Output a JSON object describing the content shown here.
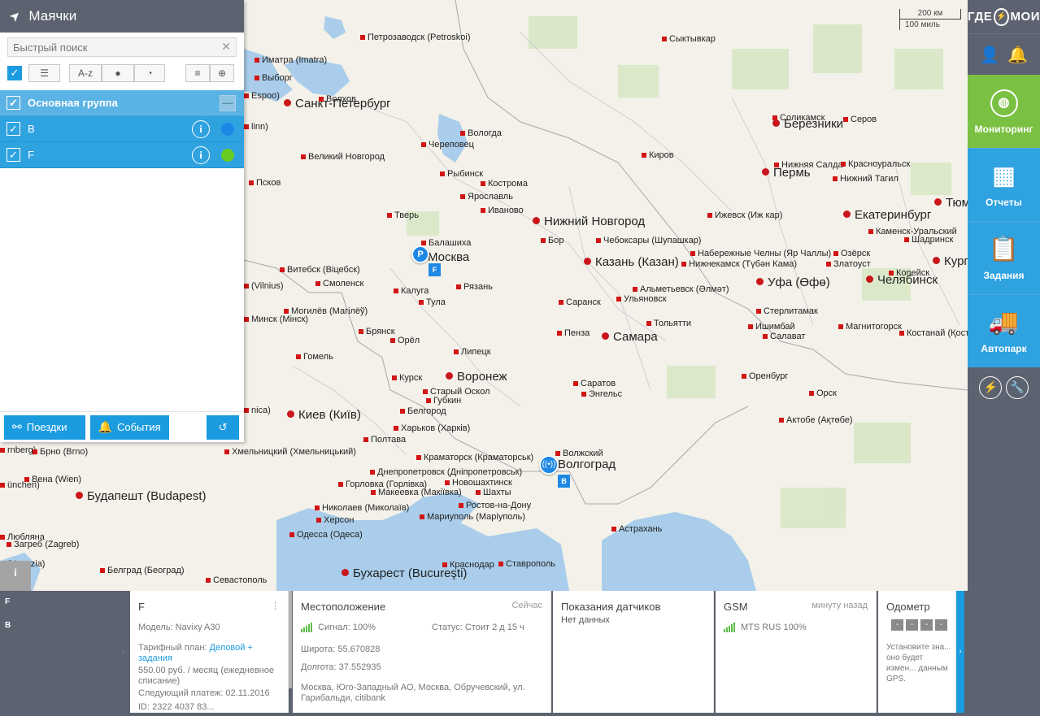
{
  "panel": {
    "title": "Маячки",
    "search_placeholder": "Быстрый поиск",
    "sort_label": "A-z",
    "groups": [
      {
        "label": "Основная группа",
        "type": "group"
      },
      {
        "label": "B",
        "type": "tracker",
        "color": "#1e88e5"
      },
      {
        "label": "F",
        "type": "tracker",
        "color": "#66cc22"
      }
    ],
    "footer": {
      "trips_label": "Поездки",
      "events_label": "События"
    }
  },
  "map": {
    "scale_km": "200 км",
    "scale_mi": "100 миль",
    "marker_p": "P",
    "marker_f": "F",
    "marker_b": "B",
    "info_btn": "i",
    "cities": [
      {
        "n": "Петрозаводск (Petroskoi)",
        "big": false
      },
      {
        "n": "Сыктывкар",
        "big": false
      },
      {
        "n": "Иматра (Imatra)",
        "big": false
      },
      {
        "n": "Выборг",
        "big": false
      },
      {
        "n": "Espoo)",
        "big": false
      },
      {
        "n": "Санкт-Петербург",
        "big": true
      },
      {
        "n": "Волхов",
        "big": false
      },
      {
        "n": "linn)",
        "big": false
      },
      {
        "n": "Вологда",
        "big": false
      },
      {
        "n": "Череповец",
        "big": false
      },
      {
        "n": "Великий Новгород",
        "big": false
      },
      {
        "n": "Киров",
        "big": false
      },
      {
        "n": "Соликамск",
        "big": false
      },
      {
        "n": "Серов",
        "big": false
      },
      {
        "n": "Березники",
        "big": true
      },
      {
        "n": "Рыбинск",
        "big": false
      },
      {
        "n": "Кострома",
        "big": false
      },
      {
        "n": "Ярославль",
        "big": false
      },
      {
        "n": "Псков",
        "big": false
      },
      {
        "n": "Нижняя Салда",
        "big": false
      },
      {
        "n": "Красноуральск",
        "big": false
      },
      {
        "n": "Пермь",
        "big": true
      },
      {
        "n": "Нижний Тагил",
        "big": false
      },
      {
        "n": "Иваново",
        "big": false
      },
      {
        "n": "Тверь",
        "big": false
      },
      {
        "n": "Ижевск (Иж кар)",
        "big": false
      },
      {
        "n": "Нижний Новгород",
        "big": true
      },
      {
        "n": "Бор",
        "big": false
      },
      {
        "n": "Екатеринбург",
        "big": true
      },
      {
        "n": "Тюм",
        "big": true
      },
      {
        "n": "Балашиха",
        "big": false
      },
      {
        "n": "Москва",
        "big": true
      },
      {
        "n": "Чебоксары (Шупашкар)",
        "big": false
      },
      {
        "n": "Каменск-Уральский",
        "big": false
      },
      {
        "n": "Шадринск",
        "big": false
      },
      {
        "n": "Набережные Челны (Яр Чаллы)",
        "big": false
      },
      {
        "n": "Озёрск",
        "big": false
      },
      {
        "n": "Казань (Казан)",
        "big": true
      },
      {
        "n": "Нижнекамск (Түбән Кама)",
        "big": false
      },
      {
        "n": "Златоуст",
        "big": false
      },
      {
        "n": "Курга",
        "big": true
      },
      {
        "n": "Витебск (Віцебск)",
        "big": false
      },
      {
        "n": "Копейск",
        "big": false
      },
      {
        "n": "Челябинск",
        "big": true
      },
      {
        "n": "Смоленск",
        "big": false
      },
      {
        "n": "(Vilnius)",
        "big": false
      },
      {
        "n": "Калуга",
        "big": false
      },
      {
        "n": "Рязань",
        "big": false
      },
      {
        "n": "Альметьевск (Әлмәт)",
        "big": false
      },
      {
        "n": "Уфа (Өфө)",
        "big": true
      },
      {
        "n": "Тула",
        "big": false
      },
      {
        "n": "Саранск",
        "big": false
      },
      {
        "n": "Ульяновск",
        "big": false
      },
      {
        "n": "Могилёв (Магілёў)",
        "big": false
      },
      {
        "n": "Стерлитамак",
        "big": false
      },
      {
        "n": "Минск (Мінск)",
        "big": false
      },
      {
        "n": "Тольятти",
        "big": false
      },
      {
        "n": "Ишимбай",
        "big": false
      },
      {
        "n": "Магнитогорск",
        "big": false
      },
      {
        "n": "Брянск",
        "big": false
      },
      {
        "n": "Пенза",
        "big": false
      },
      {
        "n": "Костанай (Қостанай)",
        "big": false
      },
      {
        "n": "Салават",
        "big": false
      },
      {
        "n": "Орёл",
        "big": false
      },
      {
        "n": "Самара",
        "big": true
      },
      {
        "n": "Гомель",
        "big": false
      },
      {
        "n": "Липецк",
        "big": false
      },
      {
        "n": "Курск",
        "big": false
      },
      {
        "n": "Воронеж",
        "big": true
      },
      {
        "n": "Оренбург",
        "big": false
      },
      {
        "n": "Саратов",
        "big": false
      },
      {
        "n": "Энгельс",
        "big": false
      },
      {
        "n": "Старый Оскол",
        "big": false
      },
      {
        "n": "Губкин",
        "big": false
      },
      {
        "n": "Орск",
        "big": false
      },
      {
        "n": "Белгород",
        "big": false
      },
      {
        "n": "nica)",
        "big": false
      },
      {
        "n": "Киев (Київ)",
        "big": true
      },
      {
        "n": "Актобе (Ақтөбе)",
        "big": false
      },
      {
        "n": "Харьков (Харків)",
        "big": false
      },
      {
        "n": "Полтава",
        "big": false
      },
      {
        "n": "rnberg)",
        "big": false
      },
      {
        "n": "Брно (Brno)",
        "big": false
      },
      {
        "n": "Хмельницкий (Хмельницький)",
        "big": false
      },
      {
        "n": "Краматорск (Краматорськ)",
        "big": false
      },
      {
        "n": "Волжский",
        "big": false
      },
      {
        "n": "Волгоград",
        "big": true
      },
      {
        "n": "Днепропетровск (Дніпропетровськ)",
        "big": false
      },
      {
        "n": "Вена (Wien)",
        "big": false
      },
      {
        "n": "ünchen)",
        "big": false
      },
      {
        "n": "Горловка (Горлівка)",
        "big": false
      },
      {
        "n": "Новошахтинск",
        "big": false
      },
      {
        "n": "Будапешт (Budapest)",
        "big": true
      },
      {
        "n": "Макеевка (Макіївка)",
        "big": false
      },
      {
        "n": "Шахты",
        "big": false
      },
      {
        "n": "Ростов-на-Дону",
        "big": false
      },
      {
        "n": "Николаев (Миколаїв)",
        "big": false
      },
      {
        "n": "Мариуполь (Маріуполь)",
        "big": false
      },
      {
        "n": "Херсон",
        "big": false
      },
      {
        "n": "Одесса (Одеса)",
        "big": false
      },
      {
        "n": "Астрахань",
        "big": false
      },
      {
        "n": "Любляна",
        "big": false
      },
      {
        "n": "Загреб (Zagreb)",
        "big": false
      },
      {
        "n": "(Venezia)",
        "big": false
      },
      {
        "n": "Краснодар",
        "big": false
      },
      {
        "n": "Ставрополь",
        "big": false
      },
      {
        "n": "Белград (Београд)",
        "big": false
      },
      {
        "n": "Севастополь",
        "big": false
      },
      {
        "n": "Бухарест (Bucureşti)",
        "big": true
      }
    ]
  },
  "sidebar": {
    "logo_left": "ГДЕ",
    "logo_right": "МОИ",
    "nav": [
      {
        "label": "Мониторинг",
        "icon": "globe-icon"
      },
      {
        "label": "Отчеты",
        "icon": "presentation-icon"
      },
      {
        "label": "Задания",
        "icon": "clipboard-icon"
      },
      {
        "label": "Автопарк",
        "icon": "truck-icon"
      }
    ]
  },
  "bottom": {
    "list": [
      "F",
      "B"
    ],
    "device": {
      "name": "F",
      "model": "Модель: Navixy A30",
      "tariff_prefix": "Тарифный план: ",
      "tariff_link": "Деловой + задания",
      "price": "550.00 руб. / месяц (ежедневное списание)",
      "next_payment": "Следующий платеж: 02.11.2016",
      "id": "ID: 2322 4037 83..."
    },
    "location": {
      "title": "Местоположение",
      "time": "Сейчас",
      "signal": "Сигнал: 100%",
      "status": "Статус: Стоит 2 д 15 ч",
      "lat": "Широта: 55.670828",
      "lon": "Долгота: 37.552935",
      "address": "Москва, Юго-Западный АО, Москва, Обручевский, ул. Гарибальди, citibank"
    },
    "sensors": {
      "title": "Показания датчиков",
      "value": "Нет данных"
    },
    "gsm": {
      "title": "GSM",
      "time": "минуту назад",
      "operator": "MTS RUS 100%"
    },
    "odometer": {
      "title": "Одометр",
      "digits": [
        "-",
        "-",
        "-",
        "-"
      ],
      "hint": "Установите зна... оно будет измен... данным GPS."
    }
  }
}
